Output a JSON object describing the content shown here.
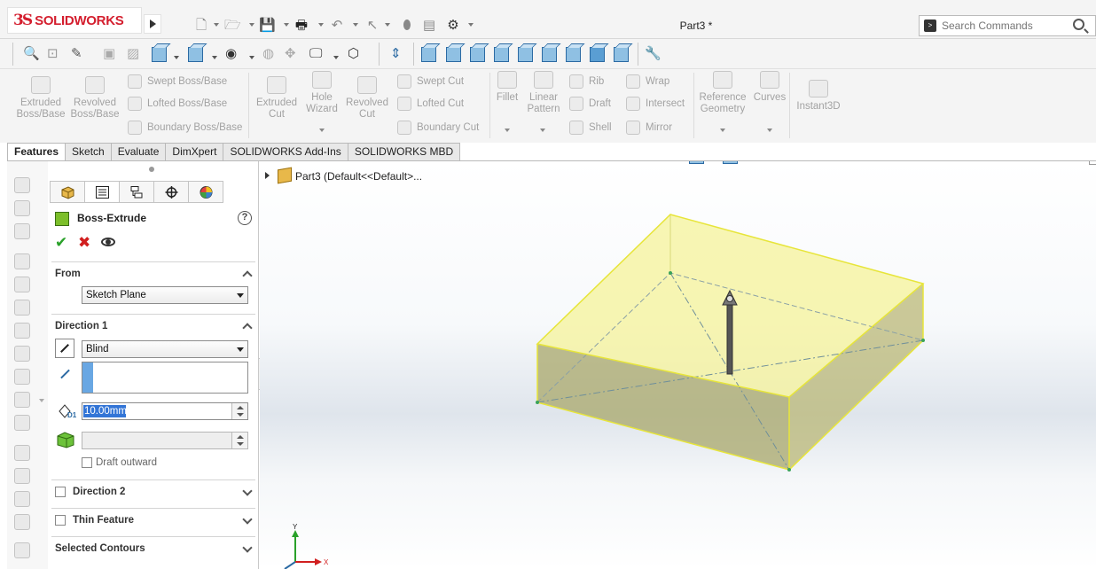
{
  "app": {
    "brand_prefix": "3S",
    "brand_name": "SOLIDWORKS",
    "document_title": "Part3 *"
  },
  "search": {
    "placeholder": "Search Commands"
  },
  "command_manager": {
    "extruded_boss": "Extruded\nBoss/Base",
    "revolved_boss": "Revolved\nBoss/Base",
    "swept_boss": "Swept Boss/Base",
    "lofted_boss": "Lofted Boss/Base",
    "boundary_boss": "Boundary Boss/Base",
    "extruded_cut": "Extruded\nCut",
    "hole_wizard": "Hole\nWizard",
    "revolved_cut": "Revolved\nCut",
    "swept_cut": "Swept Cut",
    "lofted_cut": "Lofted Cut",
    "boundary_cut": "Boundary Cut",
    "fillet": "Fillet",
    "linear_pattern": "Linear\nPattern",
    "rib": "Rib",
    "draft": "Draft",
    "shell": "Shell",
    "wrap": "Wrap",
    "intersect": "Intersect",
    "mirror": "Mirror",
    "reference_geometry": "Reference\nGeometry",
    "curves": "Curves",
    "instant3d": "Instant3D"
  },
  "tabs": [
    "Features",
    "Sketch",
    "Evaluate",
    "DimXpert",
    "SOLIDWORKS Add-Ins",
    "SOLIDWORKS MBD"
  ],
  "property_manager": {
    "title": "Boss-Extrude",
    "help": "?",
    "from_label": "From",
    "from_value": "Sketch Plane",
    "direction1_label": "Direction 1",
    "end_condition": "Blind",
    "depth_value": "10.00mm",
    "draft_outward": "Draft outward",
    "direction2_label": "Direction 2",
    "thin_feature_label": "Thin Feature",
    "selected_contours_label": "Selected Contours"
  },
  "feature_tree": {
    "root": "Part3  (Default<<Default>..."
  },
  "triad": {
    "x": "X",
    "y": "Y"
  },
  "colors": {
    "brand": "#d41e2e",
    "accent_blue": "#2b6aa3",
    "preview_yellow": "#f3f06a",
    "ok_green": "#2aa12a",
    "cancel_red": "#d11f1f"
  }
}
